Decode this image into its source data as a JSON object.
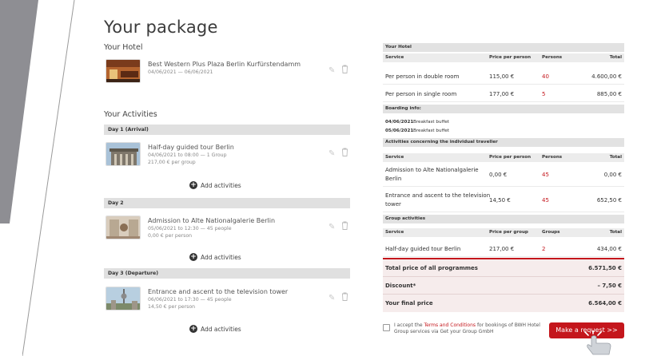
{
  "page": {
    "title": "Your package"
  },
  "hotel": {
    "section_label": "Your Hotel",
    "name": "Best Western Plus Plaza Berlin Kurfürstendamm",
    "dates": "04/06/2021 — 06/06/2021"
  },
  "activities": {
    "section_label": "Your Activities",
    "add_label": "Add activities",
    "days": [
      {
        "label": "Day 1 (Arrival)",
        "item": {
          "name": "Half-day guided tour Berlin",
          "detail": "04/06/2021 to 08:00 — 1 Group",
          "price": "217,00 € per group"
        }
      },
      {
        "label": "Day 2",
        "item": {
          "name": "Admission to Alte Nationalgalerie Berlin",
          "detail": "05/06/2021 to 12:30 — 45 people",
          "price": "0,00 € per person"
        }
      },
      {
        "label": "Day 3 (Departure)",
        "item": {
          "name": "Entrance and ascent to the television tower",
          "detail": "06/06/2021 to 17:30 — 45 people",
          "price": "14,50 € per person"
        }
      }
    ]
  },
  "summary": {
    "hotel": {
      "title": "Your Hotel",
      "cols": [
        "Service",
        "Price per person",
        "Persons",
        "Total"
      ],
      "rows": [
        [
          "Per person in double room",
          "115,00 €",
          "40",
          "4.600,00 €"
        ],
        [
          "Per person in single room",
          "177,00 €",
          "5",
          "885,00 €"
        ]
      ]
    },
    "boarding": {
      "title": "Boarding info:",
      "lines": [
        {
          "date": "04/06/2021",
          "text": "Breakfast buffet"
        },
        {
          "date": "05/06/2021",
          "text": "Breakfast buffet"
        }
      ]
    },
    "individual": {
      "title": "Activities concerning the individual traveller",
      "cols": [
        "Service",
        "Price per person",
        "Persons",
        "Total"
      ],
      "rows": [
        [
          "Admission to Alte Nationalgalerie",
          "Berlin",
          "0,00 €",
          "45",
          "0,00 €"
        ],
        [
          "Entrance and ascent to the television",
          "tower",
          "14,50 €",
          "45",
          "652,50 €"
        ]
      ]
    },
    "group": {
      "title": "Group activities",
      "cols": [
        "Service",
        "Price per group",
        "Groups",
        "Total"
      ],
      "rows": [
        [
          "Half-day guided tour Berlin",
          "217,00 €",
          "2",
          "434,00 €"
        ]
      ]
    },
    "totals": {
      "programmes_label": "Total price of all programmes",
      "programmes_value": "6.571,50 €",
      "discount_label": "Discount*",
      "discount_value": "– 7,50 €",
      "final_label": "Your final price",
      "final_value": "6.564,00 €"
    }
  },
  "terms": {
    "prefix": "I accept the",
    "link": "Terms and Conditions",
    "suffix": "for bookings of BWH Hotel",
    "line2": "Group services via Get your Group GmbH"
  },
  "cta": {
    "label": "Make a request  >>"
  },
  "colors": {
    "accent": "#c4161c",
    "panel": "#8e8e93"
  }
}
